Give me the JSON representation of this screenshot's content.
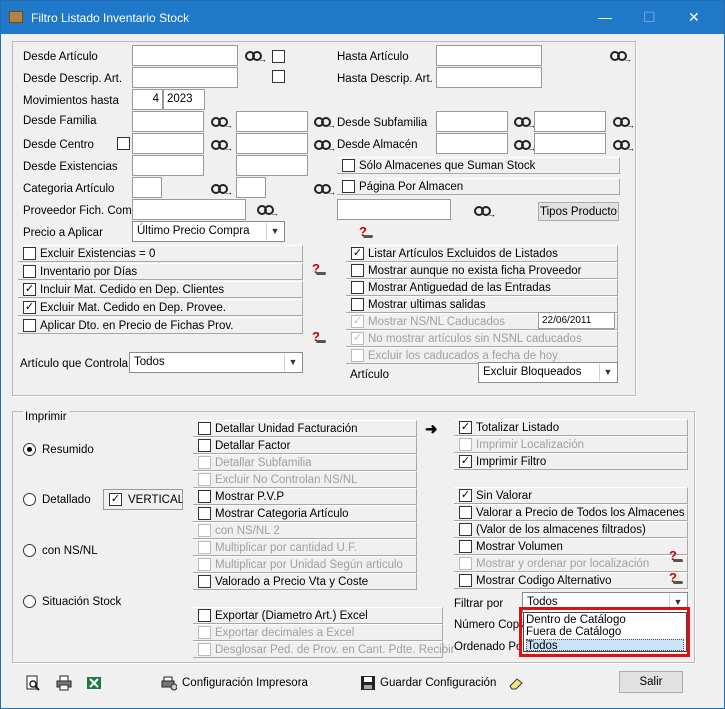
{
  "window": {
    "title": "Filtro Listado Inventario Stock",
    "min": "—",
    "max": "☐",
    "close": "✕"
  },
  "filters": {
    "desde_articulo": "Desde Artículo",
    "hasta_articulo": "Hasta Artículo",
    "desde_descrip": "Desde Descrip. Art.",
    "hasta_descrip": "Hasta Descrip. Art.",
    "movimientos": "Movimientos hasta",
    "mov_mes": "4",
    "mov_anio": "2023",
    "desde_familia": "Desde Familia",
    "desde_subfamilia": "Desde Subfamilia",
    "desde_centro": "Desde Centro",
    "desde_almacen": "Desde Almacén",
    "desde_existencias": "Desde Existencias",
    "solo_almacenes": "Sólo Almacenes que Suman Stock",
    "categoria": "Categoria Artículo",
    "pagina_almacen": "Página Por Almacen",
    "proveedor": "Proveedor Fich. Com.",
    "tipos_producto": "Tipos Producto",
    "precio_aplicar": "Precio a Aplicar",
    "precio_value": "Último Precio Compra"
  },
  "left_checks": [
    {
      "label": "Excluir Existencias = 0",
      "checked": false
    },
    {
      "label": "Inventario por Días",
      "checked": false
    },
    {
      "label": "Incluir Mat. Cedido en Dep. Clientes",
      "checked": true
    },
    {
      "label": "Excluir Mat. Cedido en Dep. Provee.",
      "checked": true
    },
    {
      "label": "Aplicar Dto. en Precio de Fichas Prov.",
      "checked": false
    }
  ],
  "right_checks": [
    {
      "label": "Listar Artículos Excluidos de Listados",
      "checked": true,
      "disabled": false
    },
    {
      "label": "Mostrar aunque no exista ficha Proveedor",
      "checked": false,
      "disabled": false
    },
    {
      "label": "Mostrar Antiguedad de las Entradas",
      "checked": false,
      "disabled": false
    },
    {
      "label": "Mostrar ultimas salidas",
      "checked": false,
      "disabled": false
    },
    {
      "label": "Mostrar NS/NL Caducados",
      "checked": true,
      "disabled": true
    },
    {
      "label": "No mostrar artículos sin NSNL caducados",
      "checked": true,
      "disabled": true
    },
    {
      "label": "Excluir los caducados a fecha de hoy",
      "checked": false,
      "disabled": true
    }
  ],
  "caducados_date": "22/06/2011",
  "articulo_controla": {
    "label": "Artículo que Controla",
    "value": "Todos"
  },
  "articulo": {
    "label": "Artículo",
    "value": "Excluir Bloqueados"
  },
  "imprimir": {
    "title": "Imprimir",
    "radios": [
      {
        "label": "Resumido",
        "on": true
      },
      {
        "label": "Detallado",
        "on": false
      },
      {
        "label": "con NS/NL",
        "on": false
      },
      {
        "label": "Situación Stock",
        "on": false
      }
    ],
    "vertical": "VERTICAL"
  },
  "mid_checks": [
    {
      "label": "Detallar Unidad Facturación",
      "checked": false,
      "disabled": false
    },
    {
      "label": "Detallar Factor",
      "checked": false,
      "disabled": false
    },
    {
      "label": "Detallar Subfamilia",
      "checked": false,
      "disabled": true
    },
    {
      "label": "Excluir No Controlan NS/NL",
      "checked": false,
      "disabled": true
    },
    {
      "label": "Mostrar P.V.P",
      "checked": false,
      "disabled": false
    },
    {
      "label": "Mostrar Categoria Artículo",
      "checked": false,
      "disabled": false
    },
    {
      "label": "con NS/NL 2",
      "checked": false,
      "disabled": true
    },
    {
      "label": "Multiplicar por cantidad U.F.",
      "checked": false,
      "disabled": true
    },
    {
      "label": "Multiplicar por Unidad Según articulo",
      "checked": false,
      "disabled": true
    },
    {
      "label": "Valorado a Precio Vta y Coste",
      "checked": false,
      "disabled": false
    }
  ],
  "export_checks": [
    {
      "label": "Exportar (Diametro Art.) Excel",
      "checked": false,
      "disabled": false
    },
    {
      "label": "Exportar decimales a Excel",
      "checked": false,
      "disabled": true
    },
    {
      "label": "Desglosar Ped. de Prov. en Cant. Pdte. Recibir",
      "checked": false,
      "disabled": true
    }
  ],
  "right1_checks": [
    {
      "label": "Totalizar Listado",
      "checked": true,
      "disabled": false
    },
    {
      "label": "Imprimir Localización",
      "checked": false,
      "disabled": true
    },
    {
      "label": "Imprimir Filtro",
      "checked": true,
      "disabled": false
    }
  ],
  "right2_checks": [
    {
      "label": "Sin Valorar",
      "checked": true,
      "disabled": false
    },
    {
      "label": "Valorar a Precio de Todos los Almacenes",
      "checked": false,
      "disabled": false
    },
    {
      "label": "(Valor de los almacenes filtrados)",
      "checked": false,
      "disabled": false
    },
    {
      "label": "Mostrar Volumen",
      "checked": false,
      "disabled": false
    },
    {
      "label": "Mostrar y ordenar por localización",
      "checked": false,
      "disabled": true
    },
    {
      "label": "Mostrar Codigo Alternativo",
      "checked": false,
      "disabled": false
    }
  ],
  "filtrar": {
    "label": "Filtrar por",
    "value": "Todos",
    "options": [
      "Dentro de Catálogo",
      "Fuera de Catálogo",
      "Todos"
    ]
  },
  "numero_copias": "Número Copias",
  "ordenado_por": "Ordenado Por",
  "footer": {
    "config_impresora": "Configuración Impresora",
    "guardar": "Guardar Configuración",
    "salir": "Salir"
  }
}
